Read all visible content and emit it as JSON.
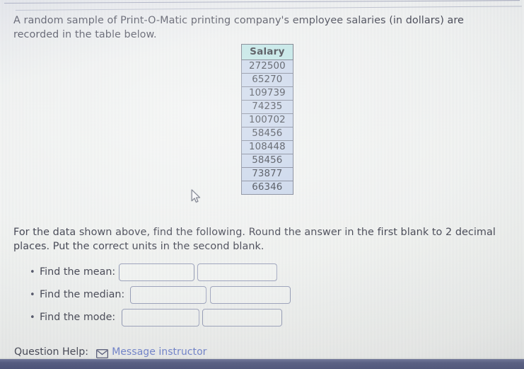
{
  "question": {
    "prompt": "A random sample of Print-O-Matic printing company's employee salaries (in dollars) are recorded in the table below.",
    "instructions": "For the data shown above, find the following. Round the answer in the first blank to 2 decimal places. Put the correct units in the second blank."
  },
  "table": {
    "header": "Salary",
    "values": [
      "272500",
      "65270",
      "109739",
      "74235",
      "100702",
      "58456",
      "108448",
      "58456",
      "73877",
      "66346"
    ]
  },
  "answers": {
    "bullet": "•",
    "rows": [
      {
        "label": "Find the mean:",
        "value1": "",
        "value2": "",
        "placeholder1": "",
        "placeholder2": ""
      },
      {
        "label": "Find the median:",
        "value1": "",
        "value2": "",
        "placeholder1": "",
        "placeholder2": ""
      },
      {
        "label": "Find the mode:",
        "value1": "",
        "value2": "",
        "placeholder1": "",
        "placeholder2": ""
      }
    ]
  },
  "help": {
    "label": "Question Help:",
    "icon": "envelope-icon",
    "link_text": "Message instructor"
  },
  "colors": {
    "table_header_bg": "#b7e2e2",
    "table_cell_bg": "#c3d1e8",
    "table_border": "#6d7488",
    "link": "#5f74c8",
    "text": "#2f3140",
    "bottom_bar": "#3f4673"
  }
}
